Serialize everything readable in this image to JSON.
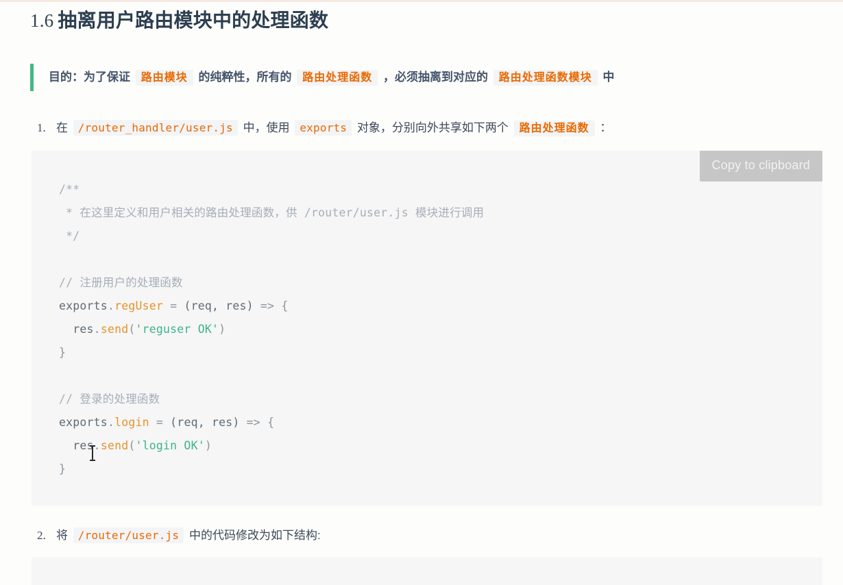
{
  "heading": {
    "number": "1.6",
    "text": "抽离用户路由模块中的处理函数"
  },
  "blockquote": {
    "seg1": "目的：为了保证",
    "code1": "路由模块",
    "seg2": "的纯粹性，所有的",
    "code2": "路由处理函数",
    "seg3": "，必须抽离到对应的",
    "code3": "路由处理函数模块",
    "seg4": "中"
  },
  "steps": [
    {
      "marker": "1.",
      "seg1": "在",
      "code1": "/router_handler/user.js",
      "seg2": "中，使用",
      "code2": "exports",
      "seg3": "对象，分别向外共享如下两个",
      "code3": "路由处理函数",
      "seg4": "："
    },
    {
      "marker": "2.",
      "seg1": "将",
      "code1": "/router/user.js",
      "seg2": "中的代码修改为如下结构:"
    }
  ],
  "code_block": {
    "copy_label": "Copy to clipboard",
    "lines": [
      {
        "tokens": [
          {
            "t": "/**",
            "c": "comment"
          }
        ]
      },
      {
        "tokens": [
          {
            "t": " * 在这里定义和用户相关的路由处理函数，供 /router/user.js 模块进行调用",
            "c": "comment"
          }
        ]
      },
      {
        "tokens": [
          {
            "t": " */",
            "c": "comment"
          }
        ]
      },
      {
        "tokens": []
      },
      {
        "tokens": [
          {
            "t": "// 注册用户的处理函数",
            "c": "comment"
          }
        ]
      },
      {
        "tokens": [
          {
            "t": "exports",
            "c": "plain"
          },
          {
            "t": ".",
            "c": "punct"
          },
          {
            "t": "regUser",
            "c": "prop"
          },
          {
            "t": " ",
            "c": "plain"
          },
          {
            "t": "=",
            "c": "op"
          },
          {
            "t": " ",
            "c": "plain"
          },
          {
            "t": "(req, res)",
            "c": "plain"
          },
          {
            "t": " ",
            "c": "plain"
          },
          {
            "t": "=>",
            "c": "op"
          },
          {
            "t": " ",
            "c": "plain"
          },
          {
            "t": "{",
            "c": "punct"
          }
        ]
      },
      {
        "tokens": [
          {
            "t": "  res",
            "c": "plain"
          },
          {
            "t": ".",
            "c": "punct"
          },
          {
            "t": "send",
            "c": "fn"
          },
          {
            "t": "(",
            "c": "punct"
          },
          {
            "t": "'reguser OK'",
            "c": "str"
          },
          {
            "t": ")",
            "c": "punct"
          }
        ]
      },
      {
        "tokens": [
          {
            "t": "}",
            "c": "punct"
          }
        ]
      },
      {
        "tokens": []
      },
      {
        "tokens": [
          {
            "t": "// 登录的处理函数",
            "c": "comment"
          }
        ]
      },
      {
        "tokens": [
          {
            "t": "exports",
            "c": "plain"
          },
          {
            "t": ".",
            "c": "punct"
          },
          {
            "t": "login",
            "c": "prop"
          },
          {
            "t": " ",
            "c": "plain"
          },
          {
            "t": "=",
            "c": "op"
          },
          {
            "t": " ",
            "c": "plain"
          },
          {
            "t": "(req, res)",
            "c": "plain"
          },
          {
            "t": " ",
            "c": "plain"
          },
          {
            "t": "=>",
            "c": "op"
          },
          {
            "t": " ",
            "c": "plain"
          },
          {
            "t": "{",
            "c": "punct"
          }
        ]
      },
      {
        "tokens": [
          {
            "t": "  res",
            "c": "plain"
          },
          {
            "t": ".",
            "c": "punct"
          },
          {
            "t": "send",
            "c": "fn"
          },
          {
            "t": "(",
            "c": "punct"
          },
          {
            "t": "'login OK'",
            "c": "str"
          },
          {
            "t": ")",
            "c": "punct"
          }
        ]
      },
      {
        "tokens": [
          {
            "t": "}",
            "c": "punct"
          }
        ]
      }
    ]
  },
  "colors": {
    "accent_green": "#42b983",
    "inline_code_text": "#e96900",
    "inline_code_bg": "#f3f4f6",
    "code_block_bg": "#f5f6f5",
    "copy_button_bg": "#c6c6c6",
    "heading_text": "#2c3e50",
    "string_token": "#3fb28f",
    "property_token": "#e8912d",
    "comment_token": "#a7adba"
  }
}
